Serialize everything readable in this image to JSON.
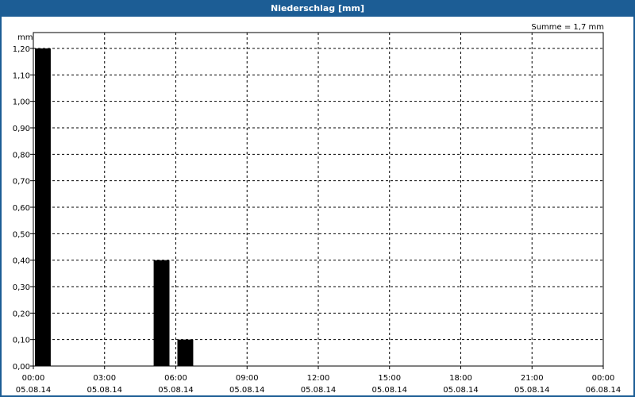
{
  "window": {
    "title": "Niederschlag [mm]"
  },
  "chart_data": {
    "type": "bar",
    "title": "Niederschlag [mm]",
    "unit_label": "mm",
    "annotation": "Summe = 1,7 mm",
    "y_range": [
      0,
      1.2
    ],
    "y_ticks": [
      "0,00",
      "0,10",
      "0,20",
      "0,30",
      "0,40",
      "0,50",
      "0,60",
      "0,70",
      "0,80",
      "0,90",
      "1,00",
      "1,10",
      "1,20"
    ],
    "x_range_hours": [
      0,
      24
    ],
    "x_ticks": [
      {
        "time": "00:00",
        "date": "05.08.14"
      },
      {
        "time": "03:00",
        "date": "05.08.14"
      },
      {
        "time": "06:00",
        "date": "05.08.14"
      },
      {
        "time": "09:00",
        "date": "05.08.14"
      },
      {
        "time": "12:00",
        "date": "05.08.14"
      },
      {
        "time": "15:00",
        "date": "05.08.14"
      },
      {
        "time": "18:00",
        "date": "05.08.14"
      },
      {
        "time": "21:00",
        "date": "05.08.14"
      },
      {
        "time": "00:00",
        "date": "06.08.14"
      }
    ],
    "bars": [
      {
        "start_hour": 0,
        "end_hour": 1,
        "value": 1.2
      },
      {
        "start_hour": 5,
        "end_hour": 6,
        "value": 0.4
      },
      {
        "start_hour": 6,
        "end_hour": 7,
        "value": 0.1
      }
    ],
    "grid": true,
    "bar_color": "#000000"
  }
}
